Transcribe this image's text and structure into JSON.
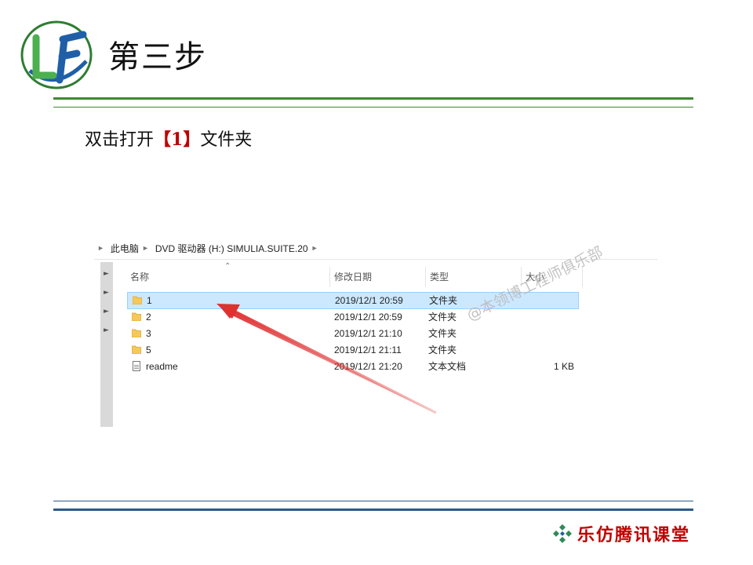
{
  "header": {
    "logo_text": "LF",
    "title": "第三步"
  },
  "instruction": {
    "prefix": "双击打开",
    "highlight": "【1】",
    "suffix": "文件夹"
  },
  "explorer": {
    "breadcrumb": [
      "此电脑",
      "DVD 驱动器 (H:) SIMULIA.SUITE.20"
    ],
    "columns": [
      "名称",
      "修改日期",
      "类型",
      "大小"
    ],
    "rows": [
      {
        "name": "1",
        "date": "2019/12/1 20:59",
        "type": "文件夹",
        "size": "",
        "icon": "folder-icon",
        "selected": true
      },
      {
        "name": "2",
        "date": "2019/12/1 20:59",
        "type": "文件夹",
        "size": "",
        "icon": "folder-icon",
        "selected": false
      },
      {
        "name": "3",
        "date": "2019/12/1 21:10",
        "type": "文件夹",
        "size": "",
        "icon": "folder-icon",
        "selected": false
      },
      {
        "name": "5",
        "date": "2019/12/1 21:11",
        "type": "文件夹",
        "size": "",
        "icon": "folder-icon",
        "selected": false
      },
      {
        "name": "readme",
        "date": "2019/12/1 21:20",
        "type": "文本文档",
        "size": "1 KB",
        "icon": "text-file-icon",
        "selected": false
      }
    ],
    "watermark": "@本领博工程师俱乐部"
  },
  "footer": {
    "brand": "乐仿腾讯课堂"
  },
  "colors": {
    "accent_green": "#3c8a2f",
    "accent_blue": "#2b5a8e",
    "highlight_red": "#c00000",
    "selection_bg": "#cce8ff",
    "arrow_red": "#e03030"
  }
}
